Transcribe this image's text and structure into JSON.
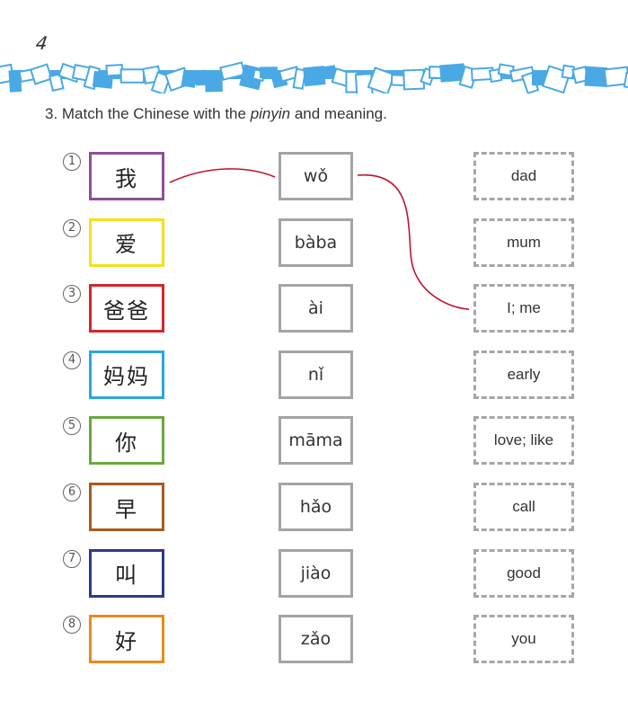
{
  "page_number": "4",
  "instruction": {
    "prefix": "3. Match the Chinese with the ",
    "italic": "pinyin",
    "suffix": " and meaning."
  },
  "colors": {
    "border_blue": "#4aa9e4",
    "match_line": "#c0142c",
    "pinyin_border": "#a4a4a4",
    "meaning_border": "#a6a6a6"
  },
  "chinese": [
    {
      "number": "1",
      "text": "我",
      "color": "#8e4f98"
    },
    {
      "number": "2",
      "text": "爱",
      "color": "#f4e117"
    },
    {
      "number": "3",
      "text": "爸爸",
      "color": "#d4262c"
    },
    {
      "number": "4",
      "text": "妈妈",
      "color": "#2aa6df"
    },
    {
      "number": "5",
      "text": "你",
      "color": "#6aa83e"
    },
    {
      "number": "6",
      "text": "早",
      "color": "#a85a1e"
    },
    {
      "number": "7",
      "text": "叫",
      "color": "#2e3a8c"
    },
    {
      "number": "8",
      "text": "好",
      "color": "#e88a1c"
    }
  ],
  "pinyin": [
    "wǒ",
    "bàba",
    "ài",
    "nǐ",
    "māma",
    "hǎo",
    "jiào",
    "zǎo"
  ],
  "meanings": [
    "dad",
    "mum",
    "I; me",
    "early",
    "love; like",
    "call",
    "good",
    "you"
  ],
  "matches": [
    {
      "from_chinese": 1,
      "to_pinyin": 1
    },
    {
      "from_pinyin": 1,
      "to_meaning": 3
    }
  ]
}
